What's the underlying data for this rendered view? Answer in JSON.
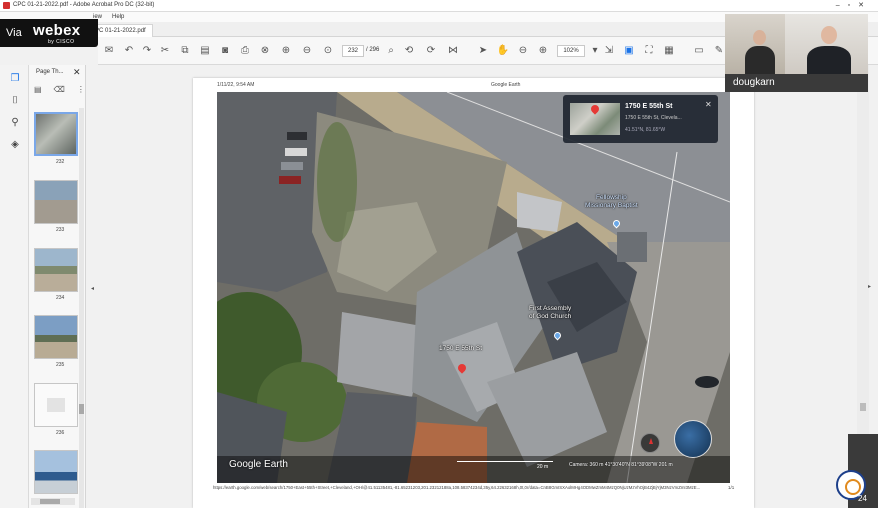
{
  "window": {
    "title": "CPC 01-21-2022.pdf - Adobe Acrobat Pro DC (32-bit)",
    "menu_view": "iew",
    "menu_help": "Help",
    "tab_label": "PC 01-21-2022.pdf"
  },
  "webex": {
    "via": "Via",
    "logo": "webex",
    "by": "by CISCO"
  },
  "toolbar": {
    "page_current": "232",
    "page_total": "/ 296",
    "zoom": "102%"
  },
  "thumbnails": {
    "header": "Page Th...",
    "close": "✕",
    "pages": [
      "232",
      "233",
      "234",
      "235",
      "236"
    ]
  },
  "document": {
    "date_time": "1/11/22, 9:54 AM",
    "header_title": "Google Earth",
    "footer_url": "https://earth.google.com/web/search/1750+East+55th+Street,+Cleveland,+OH/@41.51135481,-81.65231203,201.23212188a,108.58374234d,35y,64.22632168h,0t,0r/data=CnB8GmISXAolMHg4ODMwZmM4MzQ0NjUzMzVhOjB4ZjBjYjM3NzVmZmI3MzE...",
    "footer_page": "1/1"
  },
  "map": {
    "logo": "Google Earth",
    "scale": "20 m",
    "status": "Camera: 360 m   41°30'40\"N 81°39'08\"W   201 m",
    "info_card": {
      "title": "1750 E 55th St",
      "address": "1750 E 55th St, Clevela...",
      "coords": "41.51°N, 81.65°W",
      "close": "✕"
    },
    "labels": {
      "church1": "Fellowship\nMissionary Baptist",
      "church2": "First Assembly\nof God Church",
      "address": "1750 E 55th St"
    }
  },
  "video": {
    "participant_name": "dougkarn"
  },
  "corner_page": "24"
}
